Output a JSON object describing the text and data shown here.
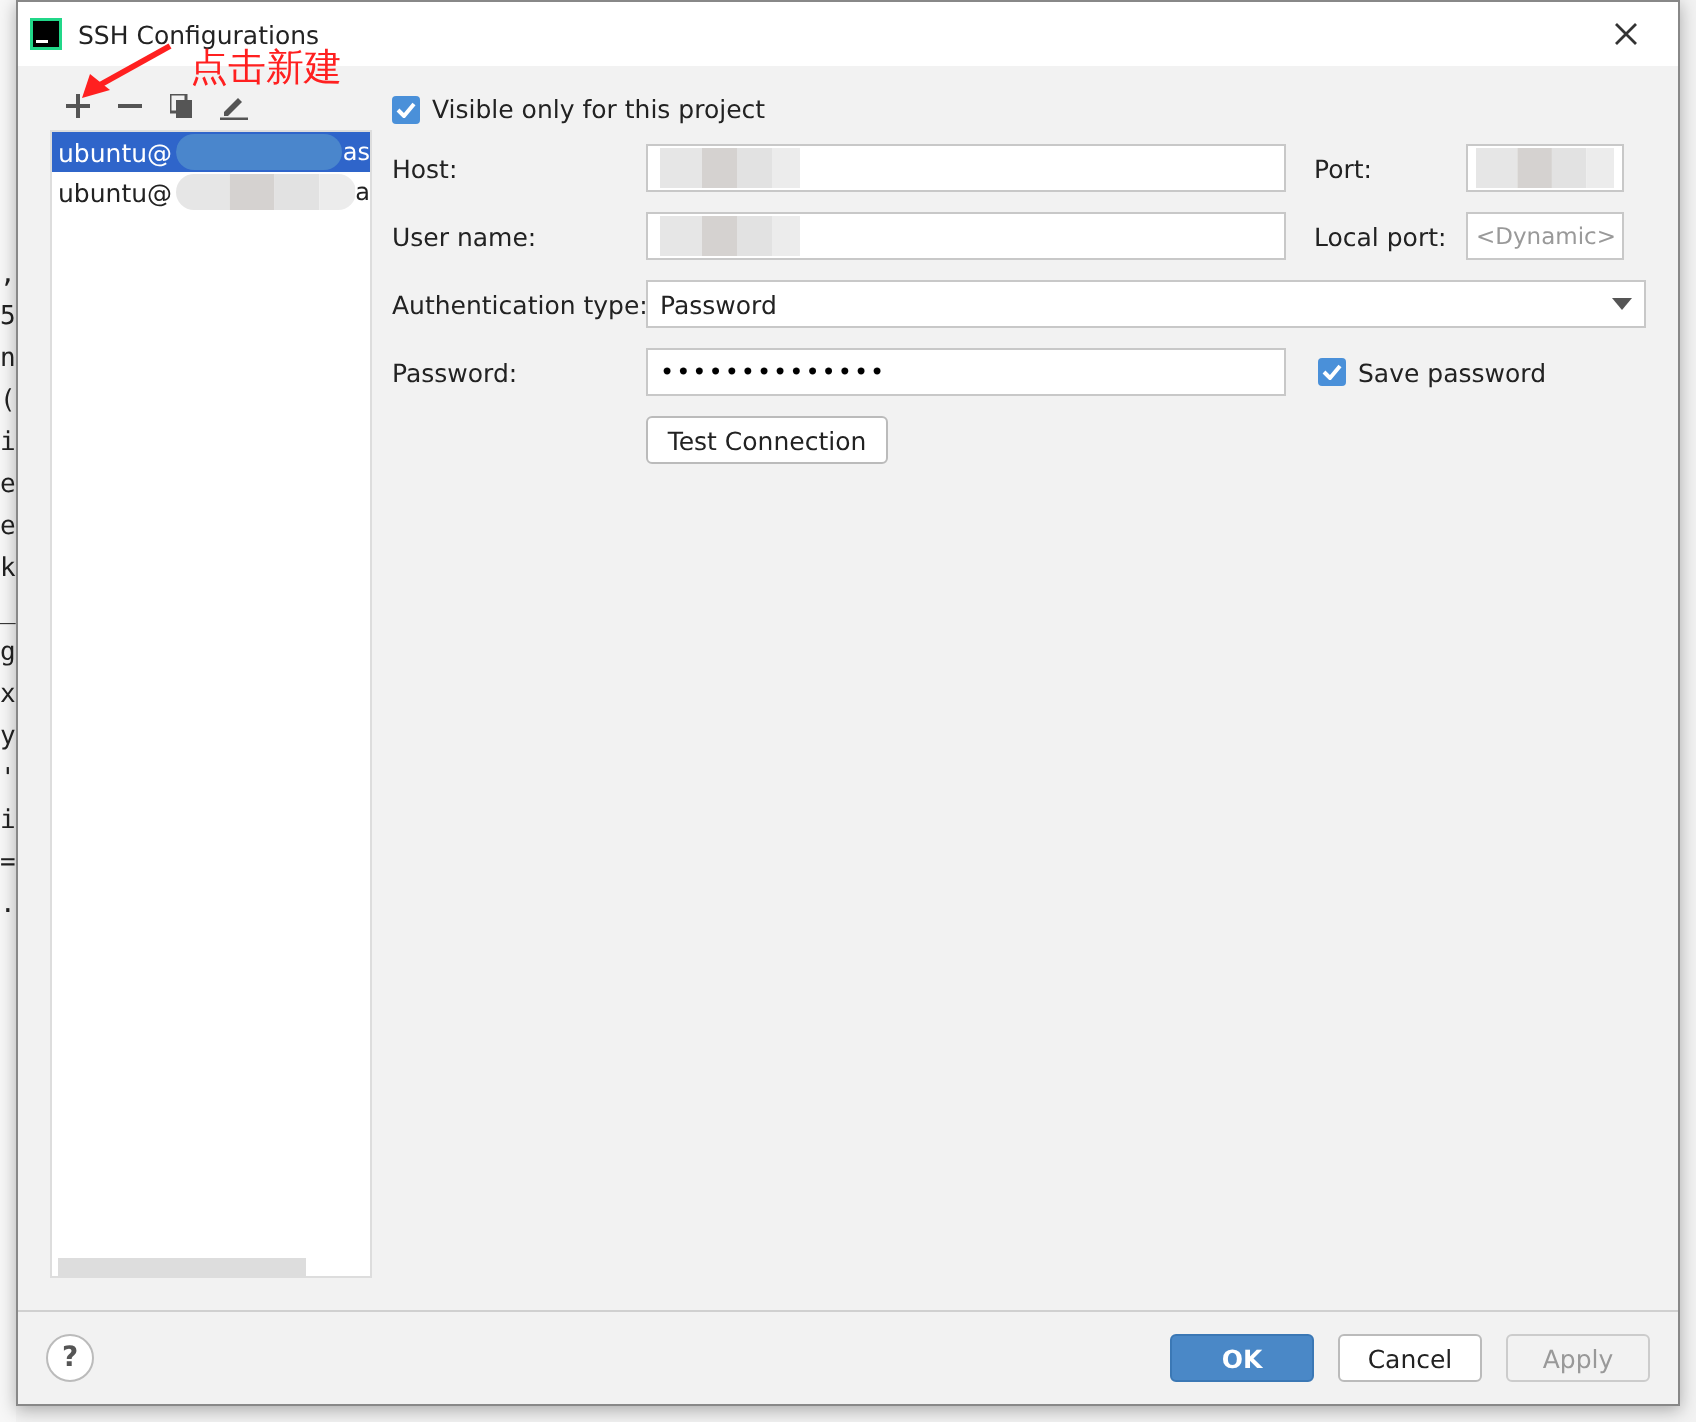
{
  "background_code": [
    ",",
    "5",
    "n",
    "(",
    "i",
    "e",
    "e",
    "k",
    "_",
    "g",
    "x",
    "y",
    "'",
    "i",
    "=",
    "."
  ],
  "window": {
    "title": "SSH Configurations"
  },
  "annotation": {
    "text": "点击新建"
  },
  "toolbar": [
    {
      "kind": "add"
    },
    {
      "kind": "remove"
    },
    {
      "kind": "copy"
    },
    {
      "kind": "edit"
    }
  ],
  "hosts": [
    {
      "label": "ubuntu@",
      "tail": "as",
      "selected": true
    },
    {
      "label": "ubuntu@",
      "tail": "a",
      "selected": false
    }
  ],
  "form": {
    "visible_only": {
      "label": "Visible only for this project",
      "checked": true
    },
    "host": {
      "label": "Host:"
    },
    "port": {
      "label": "Port:"
    },
    "user": {
      "label": "User name:"
    },
    "local_port": {
      "label": "Local port:",
      "placeholder": "<Dynamic>"
    },
    "auth": {
      "label": "Authentication type:",
      "value": "Password"
    },
    "password": {
      "label": "Password:",
      "value": "••••••••••••••"
    },
    "save_password": {
      "label": "Save password",
      "checked": true
    },
    "test": "Test Connection"
  },
  "buttons": [
    {
      "label": "OK",
      "kind": "primary"
    },
    {
      "label": "Cancel",
      "kind": "normal"
    },
    {
      "label": "Apply",
      "kind": "disabled"
    }
  ],
  "help": "?"
}
